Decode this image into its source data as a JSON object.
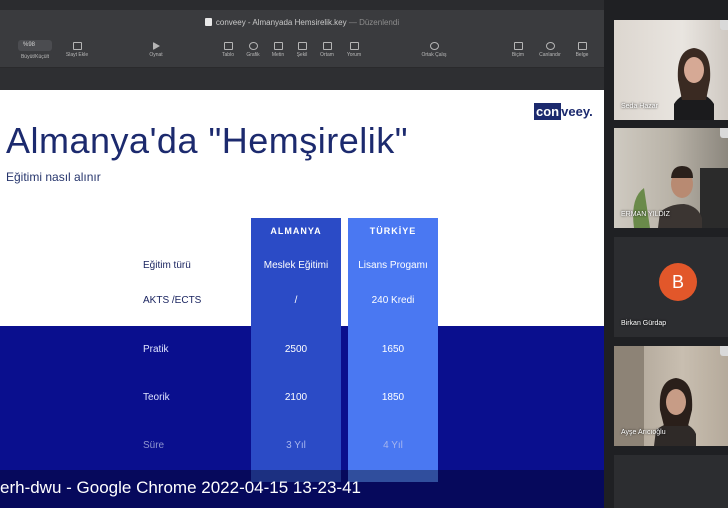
{
  "window": {
    "title_prefix": "conveey - ",
    "title_file": "Almanyada Hemsirelik.key",
    "title_edited": " — Düzenlendi"
  },
  "toolbar": {
    "zoom": "%98",
    "items": [
      "Büyüt/Küçült",
      "Slayt Ekle",
      "Oynat",
      "Tablo",
      "Grafik",
      "Metin",
      "Şekil",
      "Ortam",
      "Yorum",
      "Ortak Çalış",
      "Biçim",
      "Canlandır",
      "Belge"
    ]
  },
  "slide": {
    "title": "Almanya'da \"Hemşirelik\"",
    "subtitle": "Eğitimi nasıl alınır",
    "logo_a": "con",
    "logo_b": "veey.",
    "col_de": "ALMANYA",
    "col_tr": "TÜRKİYE",
    "rows": [
      {
        "label": "Eğitim türü",
        "de": "Meslek Eğitimi",
        "tr": "Lisans Progamı"
      },
      {
        "label": "AKTS /ECTS",
        "de": "/",
        "tr": "240 Kredi"
      },
      {
        "label": "Pratik",
        "de": "2500",
        "tr": "1650"
      },
      {
        "label": "Teorik",
        "de": "2100",
        "tr": "1850"
      },
      {
        "label": "Süre",
        "de": "3 Yıl",
        "tr": "4 Yıl"
      }
    ]
  },
  "caption": "erh-dwu - Google Chrome 2022-04-15 13-23-41",
  "participants": [
    {
      "name": "Seda Hazar"
    },
    {
      "name": "ERMAN YILDIZ"
    },
    {
      "name": "Birkan Gürdap",
      "initial": "B"
    },
    {
      "name": "Ayşe Arıcıoğlu"
    }
  ]
}
